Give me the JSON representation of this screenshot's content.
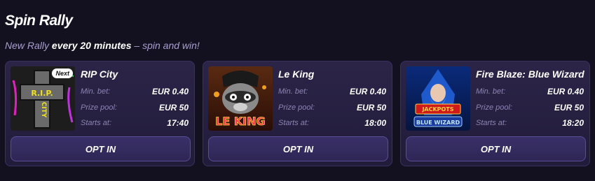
{
  "header": {
    "title": "Spin Rally",
    "subtitle_pre": "New Rally ",
    "subtitle_bold": "every 20 minutes",
    "subtitle_post": " – spin and win!"
  },
  "labels": {
    "min_bet": "Min. bet:",
    "prize_pool": "Prize pool:",
    "starts_at": "Starts at:",
    "opt_in": "OPT IN"
  },
  "cards": [
    {
      "game": "RIP City",
      "badge": "Next",
      "thumb_icon": "rip-city-cross-icon",
      "thumb_text": "R.I.P. CITY",
      "min_bet": "EUR 0.40",
      "prize_pool": "EUR 50",
      "starts_at": "17:40"
    },
    {
      "game": "Le King",
      "thumb_icon": "le-king-raccoon-icon",
      "thumb_text": "LE KING",
      "min_bet": "EUR 0.40",
      "prize_pool": "EUR 50",
      "starts_at": "18:00"
    },
    {
      "game": "Fire Blaze: Blue Wizard",
      "thumb_icon": "blue-wizard-icon",
      "thumb_text": "FIRE BLAZE JACKPOTS BLUE WIZARD",
      "min_bet": "EUR 0.40",
      "prize_pool": "EUR 50",
      "starts_at": "18:20"
    }
  ],
  "colors": {
    "background": "#13101f",
    "card": "#2b2447",
    "button": "#3a3069",
    "label": "#8d84b3"
  }
}
